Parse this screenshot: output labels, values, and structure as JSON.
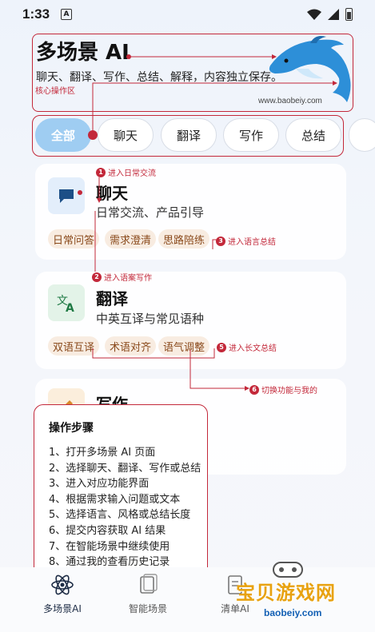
{
  "status": {
    "time": "1:33",
    "badge": "A"
  },
  "header": {
    "title": "多场景 AI",
    "subtitle": "聊天、翻译、写作、总结、解释，内容独立保存。",
    "core_label": "核心操作区",
    "site": "www.baobeiy.com"
  },
  "tabs": [
    {
      "label": "全部",
      "active": true
    },
    {
      "label": "聊天"
    },
    {
      "label": "翻译"
    },
    {
      "label": "写作"
    },
    {
      "label": "总结"
    }
  ],
  "cards": [
    {
      "title": "聊天",
      "desc": "日常交流、产品引导",
      "chips": [
        "日常问答",
        "需求澄清",
        "思路陪练"
      ]
    },
    {
      "title": "翻译",
      "desc": "中英互译与常见语种",
      "chips": [
        "双语互译",
        "术语对齐",
        "语气调整"
      ]
    },
    {
      "title": "写作"
    }
  ],
  "annotations": {
    "a1": {
      "num": "1",
      "text": "进入日常交流"
    },
    "a2": {
      "num": "2",
      "text": "进入语案写作"
    },
    "a3": {
      "num": "3",
      "text": "进入语言总结"
    },
    "a5": {
      "num": "5",
      "text": "进入长文总结"
    },
    "a6": {
      "num": "6",
      "text": "切换功能与我的"
    }
  },
  "steps": {
    "title": "操作步骤",
    "items": [
      "1、打开多场景 AI 页面",
      "2、选择聊天、翻译、写作或总结",
      "3、进入对应功能界面",
      "4、根据需求输入问题或文本",
      "5、选择语言、风格或总结长度",
      "6、提交内容获取 AI 结果",
      "7、在智能场景中继续使用",
      "8、通过我的查看历史记录"
    ]
  },
  "nav": [
    {
      "label": "多场景AI",
      "icon": "atom-icon"
    },
    {
      "label": "智能场景",
      "icon": "cards-icon"
    },
    {
      "label": "清单AI",
      "icon": "clipboard-icon"
    }
  ],
  "watermark": {
    "text": "宝贝游戏网",
    "url": "baobeiy.com"
  },
  "colors": {
    "accent": "#c3283a",
    "tab_active": "#9fcdf2",
    "chip_bg": "#f8ece1"
  }
}
